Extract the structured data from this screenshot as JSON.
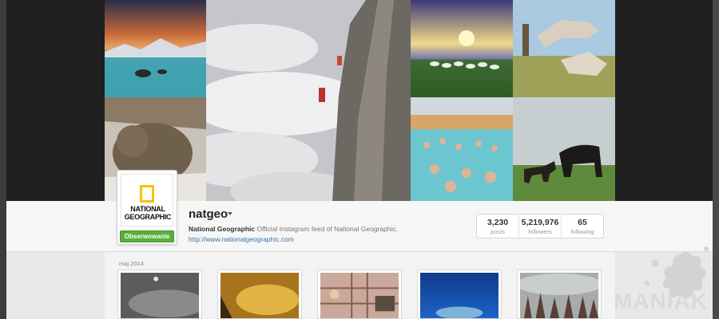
{
  "profile": {
    "logo_text": "NATIONAL GEOGRAPHIC",
    "logo_line1": "NATIONAL",
    "logo_line2": "GEOGRAPHIC",
    "username": "natgeo",
    "follow_button": "Obserwowanie",
    "bio_name": "National Geographic",
    "bio_text": " Official Instagram feed of National Geographic.",
    "website": "http://www.nationalgeographic.com"
  },
  "stats": [
    {
      "value": "3,230",
      "label": "posts"
    },
    {
      "value": "5,219,976",
      "label": "followers"
    },
    {
      "value": "65",
      "label": "following"
    }
  ],
  "feed": {
    "date_label": "maj 2014"
  },
  "mosaic_tiles": [
    {
      "name": "mountain-lake-photo"
    },
    {
      "name": "climber-on-cliff-photo"
    },
    {
      "name": "sunset-sheep-photo"
    },
    {
      "name": "running-horses-photo"
    },
    {
      "name": "bear-in-snow-photo"
    },
    {
      "name": "thermal-bath-photo"
    },
    {
      "name": "foal-and-horse-photo"
    }
  ],
  "thumbnails": [
    {
      "name": "moon-black-white-photo"
    },
    {
      "name": "golden-sunrise-photo"
    },
    {
      "name": "girl-at-fence-photo"
    },
    {
      "name": "underwater-whale-photo"
    },
    {
      "name": "forest-fog-photo"
    }
  ],
  "watermark": {
    "text": "MANIAK"
  },
  "colors": {
    "follow_green": "#5aae3c",
    "link_blue": "#3f729b",
    "ng_yellow": "#f2c500"
  }
}
